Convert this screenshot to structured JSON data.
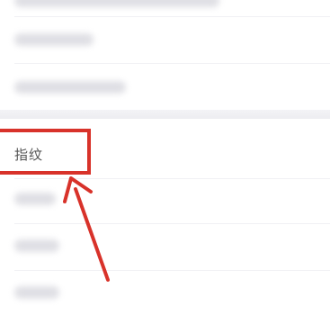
{
  "settings_list": {
    "fingerprint_item": {
      "label": "指纹"
    }
  },
  "annotation": {
    "highlight_color": "#d8322a",
    "arrow_color": "#d8322a"
  }
}
